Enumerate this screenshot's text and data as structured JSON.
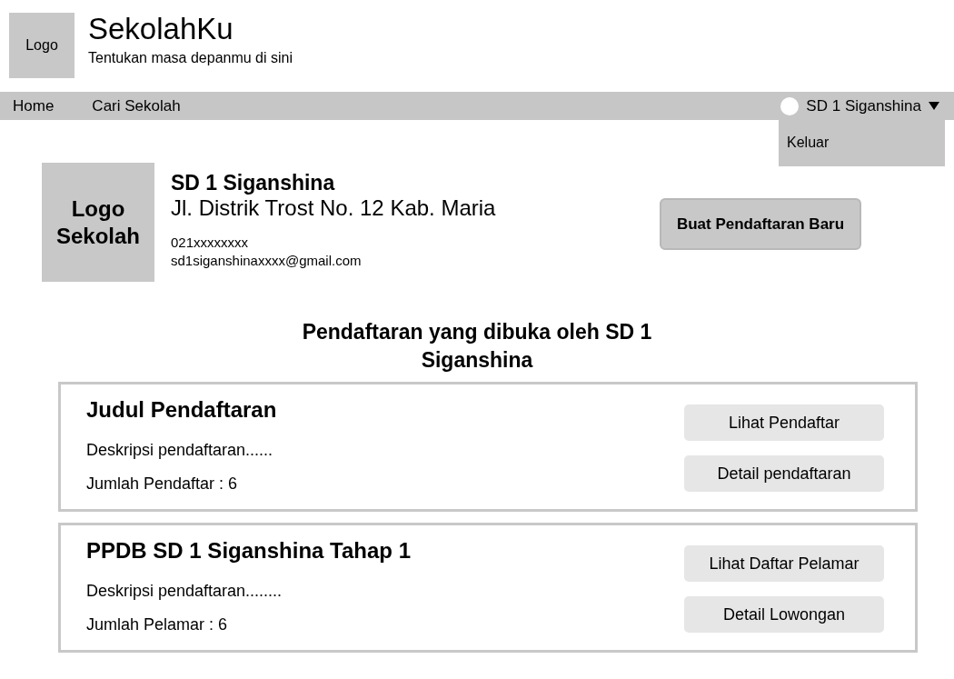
{
  "header": {
    "logo": "Logo",
    "title": "SekolahKu",
    "tagline": "Tentukan masa depanmu di sini"
  },
  "nav": {
    "items": [
      {
        "label": "Home"
      },
      {
        "label": "Cari Sekolah"
      }
    ],
    "user": {
      "name": "SD 1 Siganshina",
      "expanded": true,
      "menu": [
        "Keluar"
      ]
    }
  },
  "school": {
    "logo": "Logo Sekolah",
    "name": "SD 1 Siganshina",
    "address": "Jl. Distrik Trost No. 12 Kab. Maria",
    "phone": "021xxxxxxxx",
    "email": "sd1siganshinaxxxx@gmail.com",
    "button": "Buat Pendaftaran Baru"
  },
  "section_title": "Pendaftaran yang dibuka oleh SD 1 Siganshina",
  "registrations": [
    {
      "title": "Judul Pendaftaran",
      "description": "Deskripsi pendaftaran......",
      "count": "Jumlah Pendaftar : 6",
      "buttons": [
        "Lihat Pendaftar",
        "Detail pendaftaran"
      ]
    },
    {
      "title": "PPDB SD 1 Siganshina Tahap 1",
      "description": "Deskripsi pendaftaran........",
      "count": "Jumlah Pelamar : 6",
      "buttons": [
        "Lihat Daftar Pelamar",
        "Detail Lowongan"
      ]
    }
  ]
}
